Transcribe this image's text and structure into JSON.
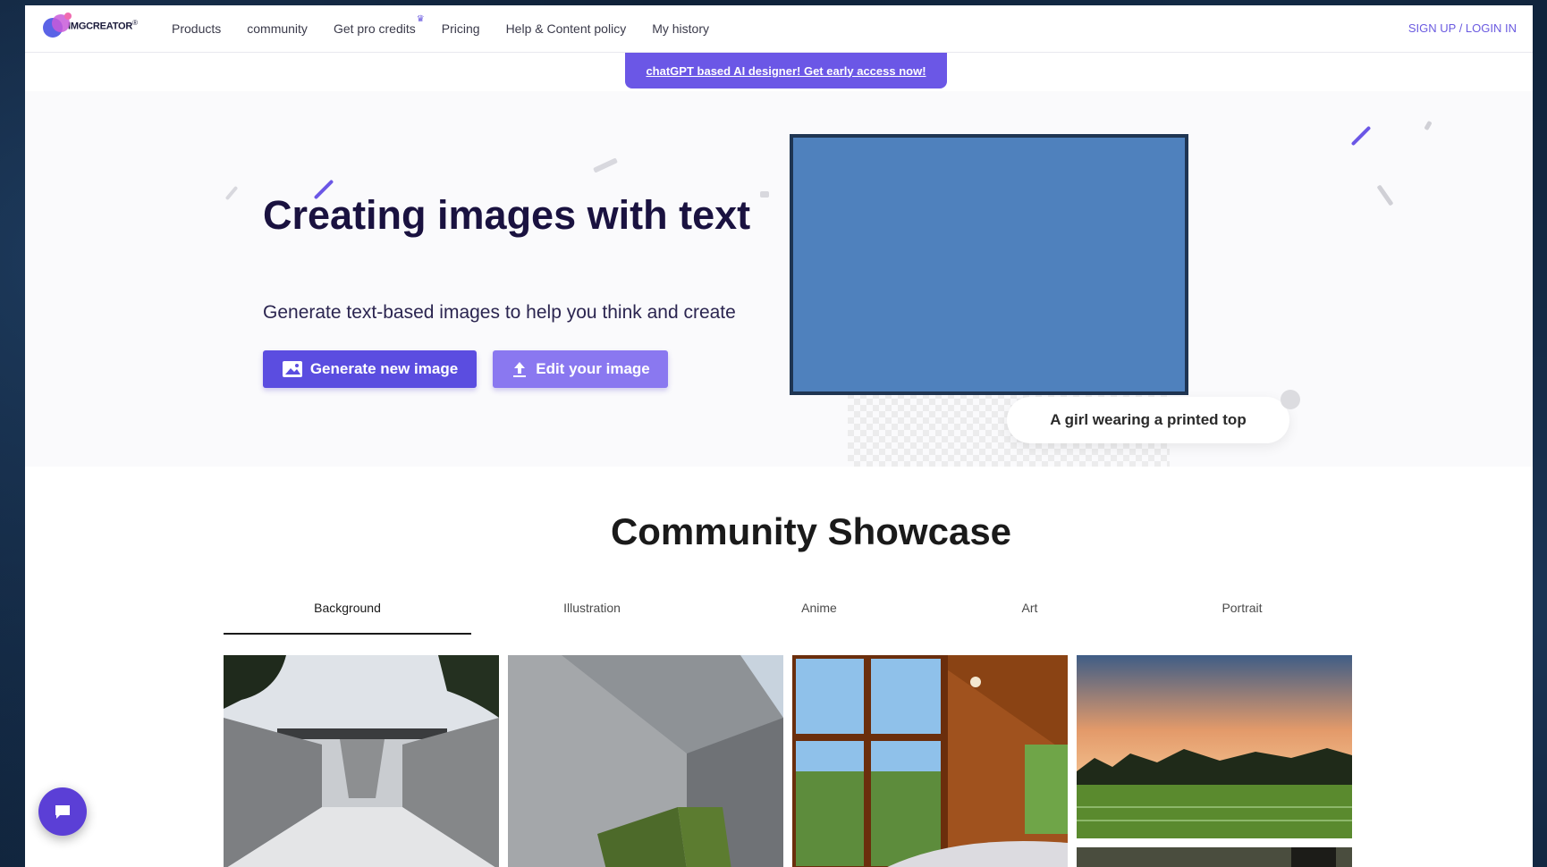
{
  "logo": {
    "text": "IMGCREATOR",
    "mark": "®"
  },
  "nav": {
    "items": [
      {
        "label": "Products"
      },
      {
        "label": "community"
      },
      {
        "label": "Get pro credits"
      },
      {
        "label": "Pricing"
      },
      {
        "label": "Help & Content policy"
      },
      {
        "label": "My history"
      }
    ],
    "auth_label": "SIGN UP / LOGIN IN"
  },
  "banner": {
    "label": "chatGPT based AI designer! Get early access now!"
  },
  "hero": {
    "title": "Creating images with text",
    "subtitle": "Generate text-based images to help you think and create",
    "generate_label": "Generate new image",
    "edit_label": "Edit your image",
    "prompt_text": "A girl wearing a printed top"
  },
  "showcase": {
    "title": "Community Showcase",
    "tabs": [
      {
        "label": "Background",
        "active": true
      },
      {
        "label": "Illustration",
        "active": false
      },
      {
        "label": "Anime",
        "active": false
      },
      {
        "label": "Art",
        "active": false
      },
      {
        "label": "Portrait",
        "active": false
      }
    ]
  },
  "colors": {
    "accent": "#5b4de0",
    "accent_light": "#8a78f0",
    "banner": "#6b57e6",
    "title": "#1a1240",
    "preview": "#4f81bd"
  },
  "icons": [
    "image-icon",
    "upload-icon",
    "crown-icon",
    "chat-icon"
  ]
}
